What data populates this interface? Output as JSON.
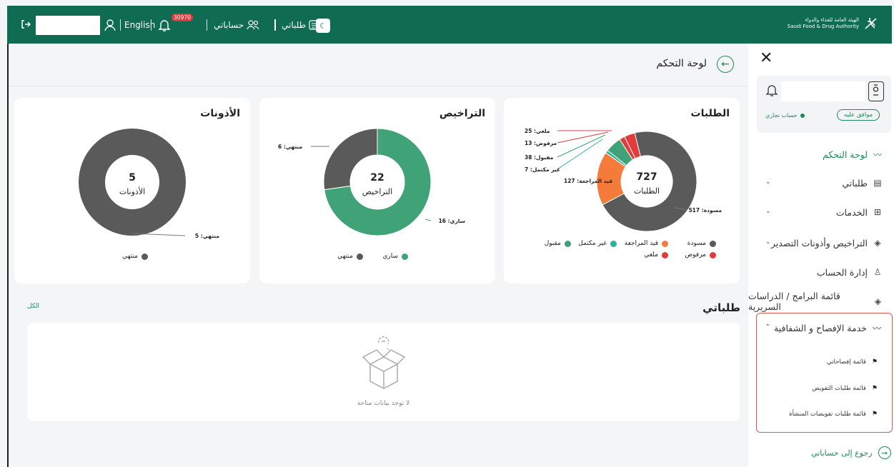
{
  "topbar": {
    "language": "English",
    "notifications_count": "30970",
    "accounts_label": "حساباتي",
    "my_requests_label": "طلباتي",
    "logo_line1": "الهيئة العامة للغذاء والدواء",
    "logo_line2": "Saudi Food & Drug Authority"
  },
  "sidebar": {
    "approved_label": "موافق عليه",
    "account_type": "حساب تجاري",
    "items": [
      {
        "label": "لوحة التحكم",
        "icon": "chart-line-icon"
      },
      {
        "label": "طلباتي",
        "icon": "list-icon"
      },
      {
        "label": "الخدمات",
        "icon": "grid-icon"
      },
      {
        "label": "التراخيص وأذونات التصدير",
        "icon": "license-icon"
      },
      {
        "label": "إدارة الحساب",
        "icon": "user-icon"
      },
      {
        "label": "قائمة البرامج / الدراسات السريرية",
        "icon": "clinical-icon"
      },
      {
        "label": "خدمة الإفصاح و الشفافية",
        "icon": "chart-line-icon"
      }
    ],
    "sub_items": [
      {
        "label": "قائمة إفصاحاتي"
      },
      {
        "label": "قائمة طلبات التفويض"
      },
      {
        "label": "قائمة طلبات تفويضات المنشأة"
      }
    ],
    "back_label": "رجوع إلى حساباتي"
  },
  "page": {
    "title": "لوحة التحكم",
    "section_title": "طلباتي",
    "all_link": "الكل",
    "empty_text": "لا توجد بيانات متاحة"
  },
  "colors": {
    "brand": "#0f6b52",
    "accent": "#1e8a5c",
    "gray": "#5a5a5a",
    "orange": "#f47b3a",
    "red": "#e23b3b",
    "teal": "#2ab39a",
    "green": "#3fa377",
    "highlight": "#e2574c"
  },
  "chart_data": [
    {
      "type": "pie",
      "title": "الطلبات",
      "center_value": "727",
      "center_label": "الطلبات",
      "slices": [
        {
          "name": "مسودة",
          "label": "مسودة: 517",
          "value": 517,
          "color": "#5a5a5a"
        },
        {
          "name": "قيد المراجعة",
          "label": "قيد المراجعة: 127",
          "value": 127,
          "color": "#f47b3a"
        },
        {
          "name": "غير مكتمل",
          "label": "غير مكتمل: 7",
          "value": 7,
          "color": "#2ab39a"
        },
        {
          "name": "مقبول",
          "label": "مقبول: 38",
          "value": 38,
          "color": "#3fa377"
        },
        {
          "name": "مرفوض",
          "label": "مرفوض: 13",
          "value": 13,
          "color": "#e23b3b"
        },
        {
          "name": "ملغي",
          "label": "ملغي: 25",
          "value": 25,
          "color": "#e23b3b"
        }
      ],
      "legend_placement": "bottom"
    },
    {
      "type": "pie",
      "title": "التراخيص",
      "center_value": "22",
      "center_label": "التراخيص",
      "slices": [
        {
          "name": "ساري",
          "label": "ساري: 16",
          "value": 16,
          "color": "#3fa377"
        },
        {
          "name": "منتهي",
          "label": "منتهي: 6",
          "value": 6,
          "color": "#5a5a5a"
        }
      ],
      "legend_placement": "bottom"
    },
    {
      "type": "pie",
      "title": "الأذونات",
      "center_value": "5",
      "center_label": "الأذونات",
      "slices": [
        {
          "name": "منتهي",
          "label": "منتهي: 5",
          "value": 5,
          "color": "#5a5a5a"
        }
      ],
      "legend_placement": "bottom"
    }
  ]
}
